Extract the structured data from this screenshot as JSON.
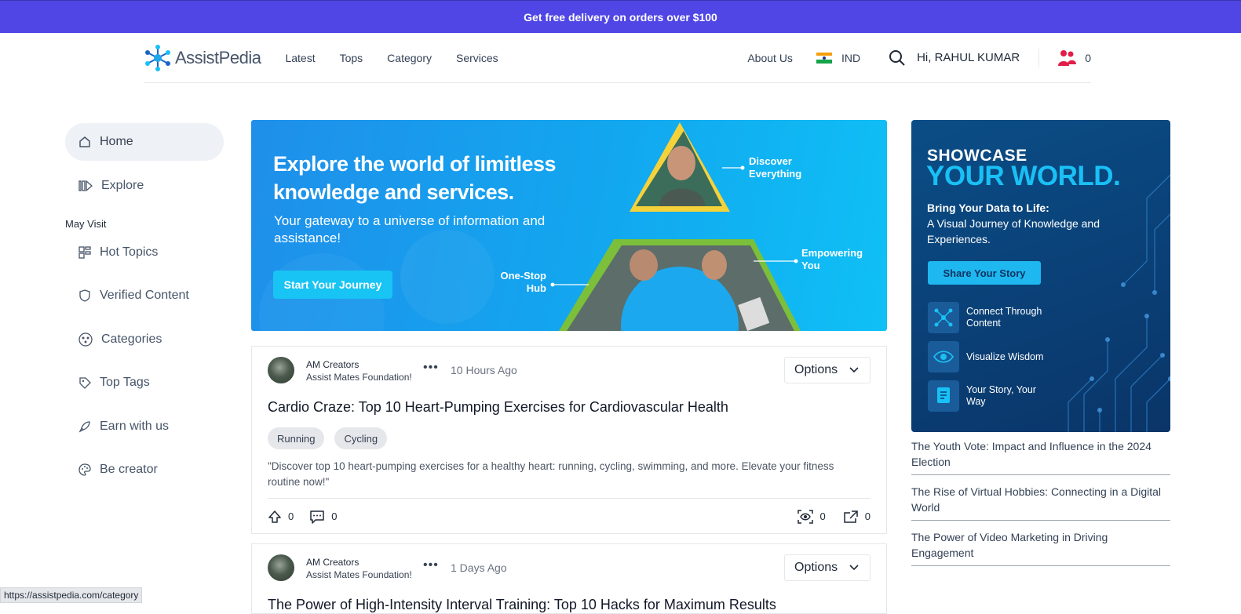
{
  "promo": {
    "text": "Get free delivery on orders over $100"
  },
  "header": {
    "logo_text": "AssistPedia",
    "nav": [
      "Latest",
      "Tops",
      "Category",
      "Services"
    ],
    "about": "About Us",
    "country": "IND",
    "greeting": "Hi, RAHUL KUMAR",
    "community_count": "0"
  },
  "sidebar": {
    "items": [
      {
        "label": "Home",
        "icon": "home-icon"
      },
      {
        "label": "Explore",
        "icon": "explore-icon"
      }
    ],
    "section_title": "May Visit",
    "visit": [
      {
        "label": "Hot Topics",
        "icon": "hot-topics-icon"
      },
      {
        "label": "Verified Content",
        "icon": "shield-icon"
      },
      {
        "label": "Categories",
        "icon": "categories-icon"
      },
      {
        "label": "Top Tags",
        "icon": "tag-icon"
      },
      {
        "label": "Earn with us",
        "icon": "rocket-icon"
      },
      {
        "label": "Be creator",
        "icon": "palette-icon"
      }
    ]
  },
  "hero": {
    "title": "Explore the world of limitless knowledge and services.",
    "subtitle": "Your gateway to a universe of information and assistance!",
    "button": "Start Your Journey",
    "labels": [
      "Discover Everything",
      "Empowering You",
      "One-Stop Hub"
    ]
  },
  "ad": {
    "line1": "SHOWCASE",
    "line2": "YOUR WORLD.",
    "sub_bold": "Bring Your Data to Life:",
    "sub_rest": "A Visual Journey of Knowledge and Experiences.",
    "button": "Share Your Story",
    "features": [
      "Connect Through Content",
      "Visualize Wisdom",
      "Your Story, Your Way"
    ]
  },
  "trending": [
    "The Youth Vote: Impact and Influence in the 2024 Election",
    "The Rise of Virtual Hobbies: Connecting in a Digital World",
    "The Power of Video Marketing in Driving Engagement"
  ],
  "posts": [
    {
      "author": "AM Creators",
      "org": "Assist Mates Foundation!",
      "time": "10 Hours Ago",
      "options": "Options",
      "title": "Cardio Craze: Top 10 Heart-Pumping Exercises for Cardiovascular Health",
      "tags": [
        "Running",
        "Cycling"
      ],
      "excerpt": "\"Discover top 10 heart-pumping exercises for a healthy heart: running, cycling, swimming, and more. Elevate your fitness routine now!\"",
      "upvotes": "0",
      "comments": "0",
      "views": "0",
      "shares": "0"
    },
    {
      "author": "AM Creators",
      "org": "Assist Mates Foundation!",
      "time": "1 Days Ago",
      "options": "Options",
      "title": "The Power of High-Intensity Interval Training: Top 10 Hacks for Maximum Results"
    }
  ],
  "status_url": "https://assistpedia.com/category",
  "colors": {
    "promo": "#4f46e5",
    "accent": "#19c0f5",
    "ad_bg": "#0a3f75"
  }
}
